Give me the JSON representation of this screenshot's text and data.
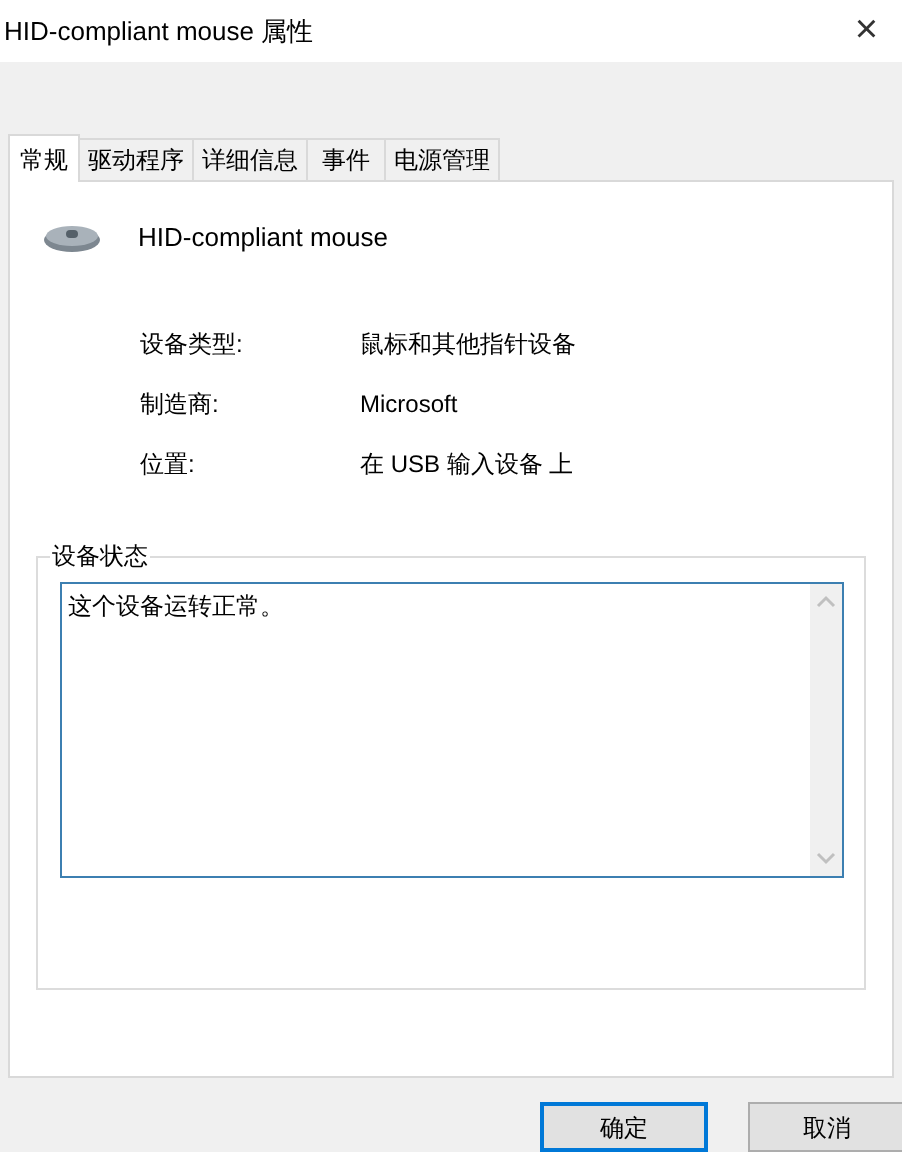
{
  "window": {
    "title": "HID-compliant mouse 属性",
    "close": "×"
  },
  "tabs": [
    {
      "label": "常规",
      "selected": true
    },
    {
      "label": "驱动程序",
      "selected": false
    },
    {
      "label": "详细信息",
      "selected": false
    },
    {
      "label": "事件",
      "selected": false
    },
    {
      "label": "电源管理",
      "selected": false
    }
  ],
  "device": {
    "name": "HID-compliant mouse"
  },
  "properties": [
    {
      "label": "设备类型:",
      "value": "鼠标和其他指针设备"
    },
    {
      "label": "制造商:",
      "value": "Microsoft"
    },
    {
      "label": "位置:",
      "value": "在 USB 输入设备 上"
    }
  ],
  "status_group": {
    "title": "设备状态",
    "value": "这个设备运转正常。"
  },
  "buttons": [
    {
      "label": "确定",
      "default": true
    },
    {
      "label": "取消",
      "default": false
    }
  ]
}
